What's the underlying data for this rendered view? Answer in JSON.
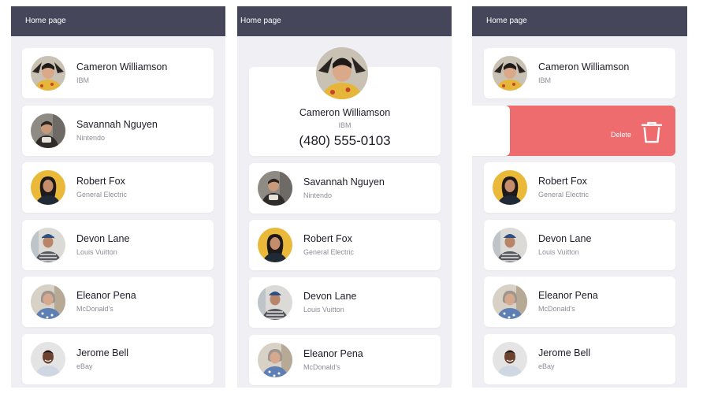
{
  "header": {
    "title": "Home page"
  },
  "contacts": [
    {
      "name": "Cameron Williamson",
      "company": "IBM",
      "phone": "(480) 555-0103"
    },
    {
      "name": "Savannah Nguyen",
      "company": "Nintendo"
    },
    {
      "name": "Robert Fox",
      "company": "General Electric"
    },
    {
      "name": "Devon Lane",
      "company": "Louis Vuitton"
    },
    {
      "name": "Eleanor Pena",
      "company": "McDonald's"
    },
    {
      "name": "Jerome Bell",
      "company": "eBay"
    }
  ],
  "swipe": {
    "delete_label": "Delete"
  },
  "icons": {
    "delete": "trash-icon"
  },
  "colors": {
    "header": "#454659",
    "background": "#efeff4",
    "delete": "#ee6b6e"
  }
}
